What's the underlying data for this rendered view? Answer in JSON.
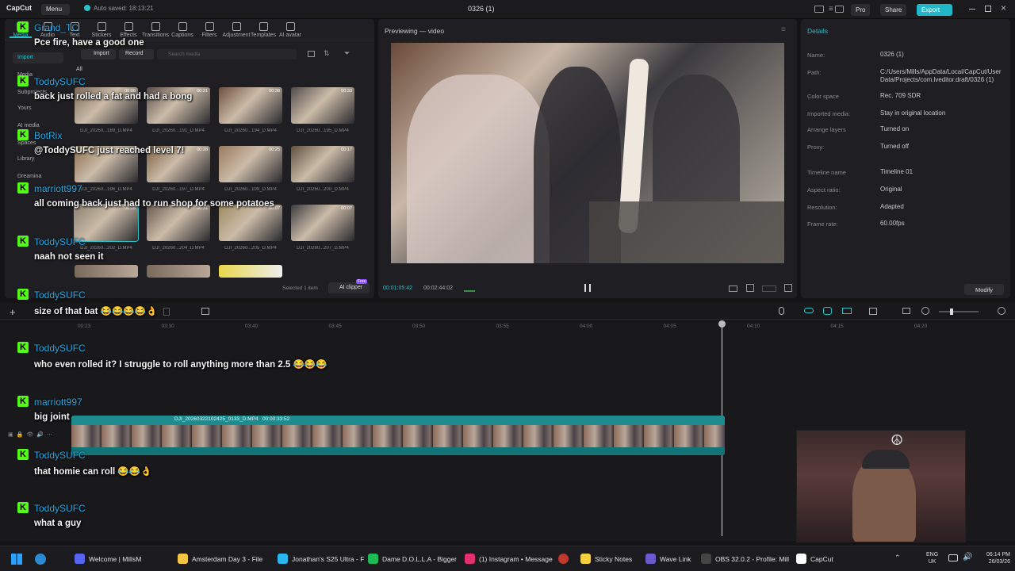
{
  "app": {
    "logo": "CapCut",
    "menu_label": "Menu",
    "autosave": "Auto saved: 18:13:21",
    "project_title": "0326 (1)",
    "pro_label": "Pro",
    "share_label": "Share",
    "export_label": "Export"
  },
  "toolbar": {
    "items": [
      "Media",
      "Audio",
      "Text",
      "Stickers",
      "Effects",
      "Transitions",
      "Captions",
      "Filters",
      "Adjustment",
      "Templates",
      "AI avatar"
    ]
  },
  "media_panel": {
    "sidebar": [
      "Import",
      "Media",
      "Subprojects",
      "Yours",
      "AI media",
      "Spaces",
      "Library",
      "Dreamina"
    ],
    "import_button": "Import",
    "record_button": "Record",
    "search_placeholder": "Search media",
    "filter_all": "All",
    "thumbs": [
      {
        "label": "DJI_20260...189_D.MP4",
        "dur": "00:06"
      },
      {
        "label": "DJI_20260...191_D.MP4",
        "dur": "00:21"
      },
      {
        "label": "DJI_20260...194_D.MP4",
        "dur": "00:38"
      },
      {
        "label": "DJI_20260...195_D.MP4",
        "dur": "00:33"
      },
      {
        "label": "DJI_20260...196_D.MP4",
        "dur": "00:06"
      },
      {
        "label": "DJI_20260...197_D.MP4",
        "dur": "00:28"
      },
      {
        "label": "DJI_20260...199_D.MP4",
        "dur": "00:25"
      },
      {
        "label": "DJI_20260...200_D.MP4",
        "dur": "00:17"
      },
      {
        "label": "DJI_20260...202_D.MP4",
        "dur": "00:28"
      },
      {
        "label": "DJI_20260...204_D.MP4",
        "dur": "00:31"
      },
      {
        "label": "DJI_20260...205_D.MP4",
        "dur": "00:07"
      },
      {
        "label": "DJI_20260...207_D.MP4",
        "dur": "00:07"
      }
    ],
    "selected_text": "Selected 1 item",
    "ai_clipper": "AI clipper",
    "free_badge": "Free"
  },
  "preview": {
    "title": "Previewing — video",
    "current_time": "00:01:05:42",
    "total_time": "00:02:44:02"
  },
  "details": {
    "tab": "Details",
    "rows": [
      {
        "k": "Name:",
        "v": "0326 (1)"
      },
      {
        "k": "Path:",
        "v": "C:/Users/Mills/AppData/Local/CapCut/User Data/Projects/com.lveditor.draft/0326 (1)"
      },
      {
        "k": "Color space",
        "v": "Rec. 709 SDR"
      },
      {
        "k": "Imported media:",
        "v": "Stay in original location"
      },
      {
        "k": "Arrange layers",
        "v": "Turned on"
      },
      {
        "k": "Proxy:",
        "v": "Turned off"
      },
      {
        "k": "Timeline name",
        "v": "Timeline 01"
      },
      {
        "k": "Aspect ratio:",
        "v": "Original"
      },
      {
        "k": "Resolution:",
        "v": "Adapted"
      },
      {
        "k": "Frame rate:",
        "v": "60.00fps"
      }
    ],
    "modify_button": "Modify"
  },
  "timeline": {
    "ruler": [
      "00:23",
      "03:30",
      "03:40",
      "03:45",
      "03:50",
      "03:55",
      "04:00",
      "04:05",
      "04:10",
      "04:15",
      "04:20"
    ],
    "clip_label": "DJI_20260322102425_0133_D.MP4   00:00:33:52"
  },
  "chat": [
    {
      "user": "Grand_TC",
      "msg": "Pce fire, have a good one"
    },
    {
      "user": "ToddySUFC",
      "msg": "back just rolled a fat and had a bong"
    },
    {
      "user": "BotRix",
      "msg": "@ToddySUFC just reached level 7!"
    },
    {
      "user": "marriott997",
      "msg": "all coming back just had to run shop for some potatoes"
    },
    {
      "user": "ToddySUFC",
      "msg": "naah not seen it"
    },
    {
      "user": "ToddySUFC",
      "msg": "size of that bat 😂😂😂😂👌"
    },
    {
      "user": "ToddySUFC",
      "msg": "who even rolled it? I struggle to roll anything more than 2.5 😂😂😂"
    },
    {
      "user": "marriott997",
      "msg": "big joint"
    },
    {
      "user": "ToddySUFC",
      "msg": "that homie can roll 😂😂👌"
    },
    {
      "user": "ToddySUFC",
      "msg": "what a guy"
    }
  ],
  "taskbar": {
    "items": [
      {
        "label": "Welcome | MillsM",
        "color": "#5865f2"
      },
      {
        "label": "Amsterdam Day 3 - File",
        "color": "#f5c542"
      },
      {
        "label": "Jonathan's S25 Ultra - F",
        "color": "#2ab6f0"
      },
      {
        "label": "Dame D.O.L.L.A - Bigger",
        "color": "#1db954"
      },
      {
        "label": "(1) Instagram • Message",
        "color": "#e1306c"
      },
      {
        "label": "Sticky Notes",
        "color": "#f4d03f"
      },
      {
        "label": "Wave Link",
        "color": "#6a5acd"
      },
      {
        "label": "OBS 32.0.2 - Profile: Mill",
        "color": "#444"
      },
      {
        "label": "CapCut",
        "color": "#fff"
      }
    ],
    "lang": "ENG",
    "region": "UK",
    "time": "06:14 PM",
    "date": "26/03/26"
  }
}
